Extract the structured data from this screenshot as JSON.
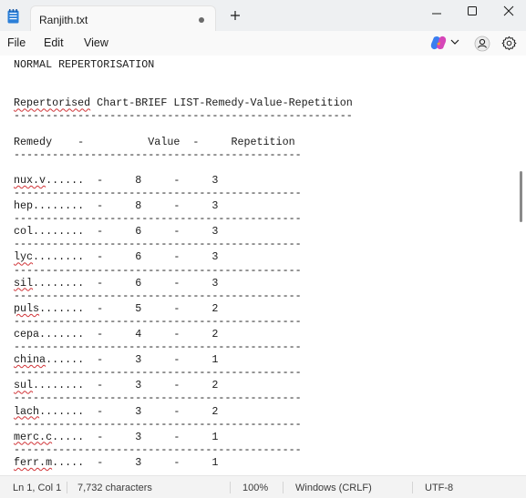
{
  "window": {
    "tab_title": "Ranjith.txt",
    "unsaved": true
  },
  "menu": {
    "file": "File",
    "edit": "Edit",
    "view": "View"
  },
  "document": {
    "lines": [
      "NORMAL REPERTORISATION",
      "",
      "",
      "Repertorised Chart-BRIEF LIST-Remedy-Value-Repetition",
      "-----------------------------------------------------",
      "",
      "Remedy    -          Value  -     Repetition",
      "---------------------------------------------",
      "",
      "nux.v......  -     8     -     3",
      "---------------------------------------------",
      "hep........  -     8     -     3",
      "---------------------------------------------",
      "col........  -     6     -     3",
      "---------------------------------------------",
      "lyc........  -     6     -     3",
      "---------------------------------------------",
      "sil........  -     6     -     3",
      "---------------------------------------------",
      "puls.......  -     5     -     2",
      "---------------------------------------------",
      "cepa.......  -     4     -     2",
      "---------------------------------------------",
      "china......  -     3     -     1",
      "---------------------------------------------",
      "sul........  -     3     -     2",
      "---------------------------------------------",
      "lach.......  -     3     -     2",
      "---------------------------------------------",
      "merc.c.....  -     3     -     1",
      "---------------------------------------------",
      "ferr.m.....  -     3     -     1"
    ],
    "spellcheck_words": [
      "Repertorised",
      "nux.v",
      "lyc",
      "sil",
      "puls",
      "china",
      "sul",
      "lach",
      "merc.c",
      "ferr.m"
    ]
  },
  "status": {
    "position": "Ln 1, Col 1",
    "characters": "7,732 characters",
    "zoom": "100%",
    "line_ending": "Windows (CRLF)",
    "encoding": "UTF-8"
  }
}
